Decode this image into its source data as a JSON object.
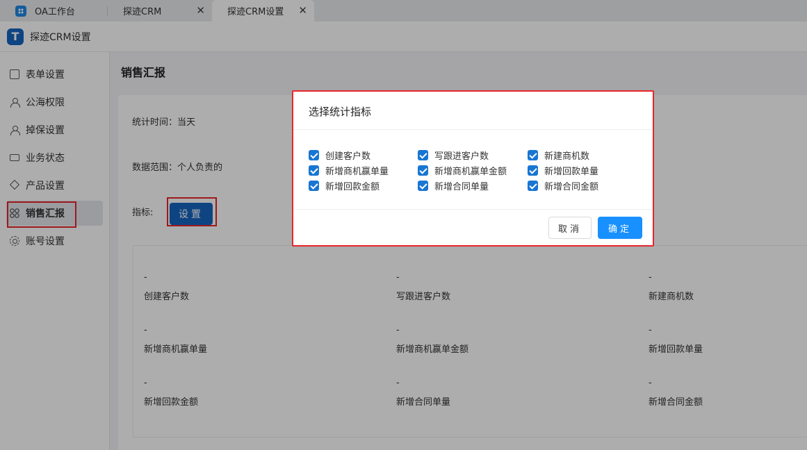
{
  "tabs": [
    {
      "label": "OA工作台",
      "icon": "app-grid-icon"
    },
    {
      "label": "探迹CRM"
    },
    {
      "label": "探迹CRM设置"
    }
  ],
  "app": {
    "logo_text": "T",
    "title": "探迹CRM设置"
  },
  "sidebar": {
    "items": [
      {
        "label": "表单设置",
        "icon": "form-icon"
      },
      {
        "label": "公海权限",
        "icon": "user-icon"
      },
      {
        "label": "掉保设置",
        "icon": "user-shield-icon"
      },
      {
        "label": "业务状态",
        "icon": "monitor-icon"
      },
      {
        "label": "产品设置",
        "icon": "layers-icon"
      },
      {
        "label": "销售汇报",
        "icon": "grid-icon",
        "active": true
      },
      {
        "label": "账号设置",
        "icon": "gear-icon"
      }
    ]
  },
  "main": {
    "title": "销售汇报",
    "stat_time": "统计时间：当天",
    "data_range": "数据范围：个人负责的",
    "metric_label": "指标:",
    "setting_button": "设置",
    "metrics": [
      {
        "value": "-",
        "label": "创建客户数"
      },
      {
        "value": "-",
        "label": "写跟进客户数"
      },
      {
        "value": "-",
        "label": "新建商机数"
      },
      {
        "value": "-",
        "label": "新增商机赢单量"
      },
      {
        "value": "-",
        "label": "新增商机赢单金额"
      },
      {
        "value": "-",
        "label": "新增回款单量"
      },
      {
        "value": "-",
        "label": "新增回款金额"
      },
      {
        "value": "-",
        "label": "新增合同单量"
      },
      {
        "value": "-",
        "label": "新增合同金额"
      }
    ]
  },
  "modal": {
    "title": "选择统计指标",
    "options": [
      {
        "label": "创建客户数",
        "checked": true
      },
      {
        "label": "写跟进客户数",
        "checked": true
      },
      {
        "label": "新建商机数",
        "checked": true
      },
      {
        "label": "新增商机赢单量",
        "checked": true
      },
      {
        "label": "新增商机赢单金额",
        "checked": true
      },
      {
        "label": "新增回款单量",
        "checked": true
      },
      {
        "label": "新增回款金额",
        "checked": true
      },
      {
        "label": "新增合同单量",
        "checked": true
      },
      {
        "label": "新增合同金额",
        "checked": true
      }
    ],
    "cancel_label": "取消",
    "ok_label": "确定"
  },
  "colors": {
    "accent": "#1890ff",
    "dark_blue": "#1565c0",
    "highlight_red": "#e8262b"
  }
}
